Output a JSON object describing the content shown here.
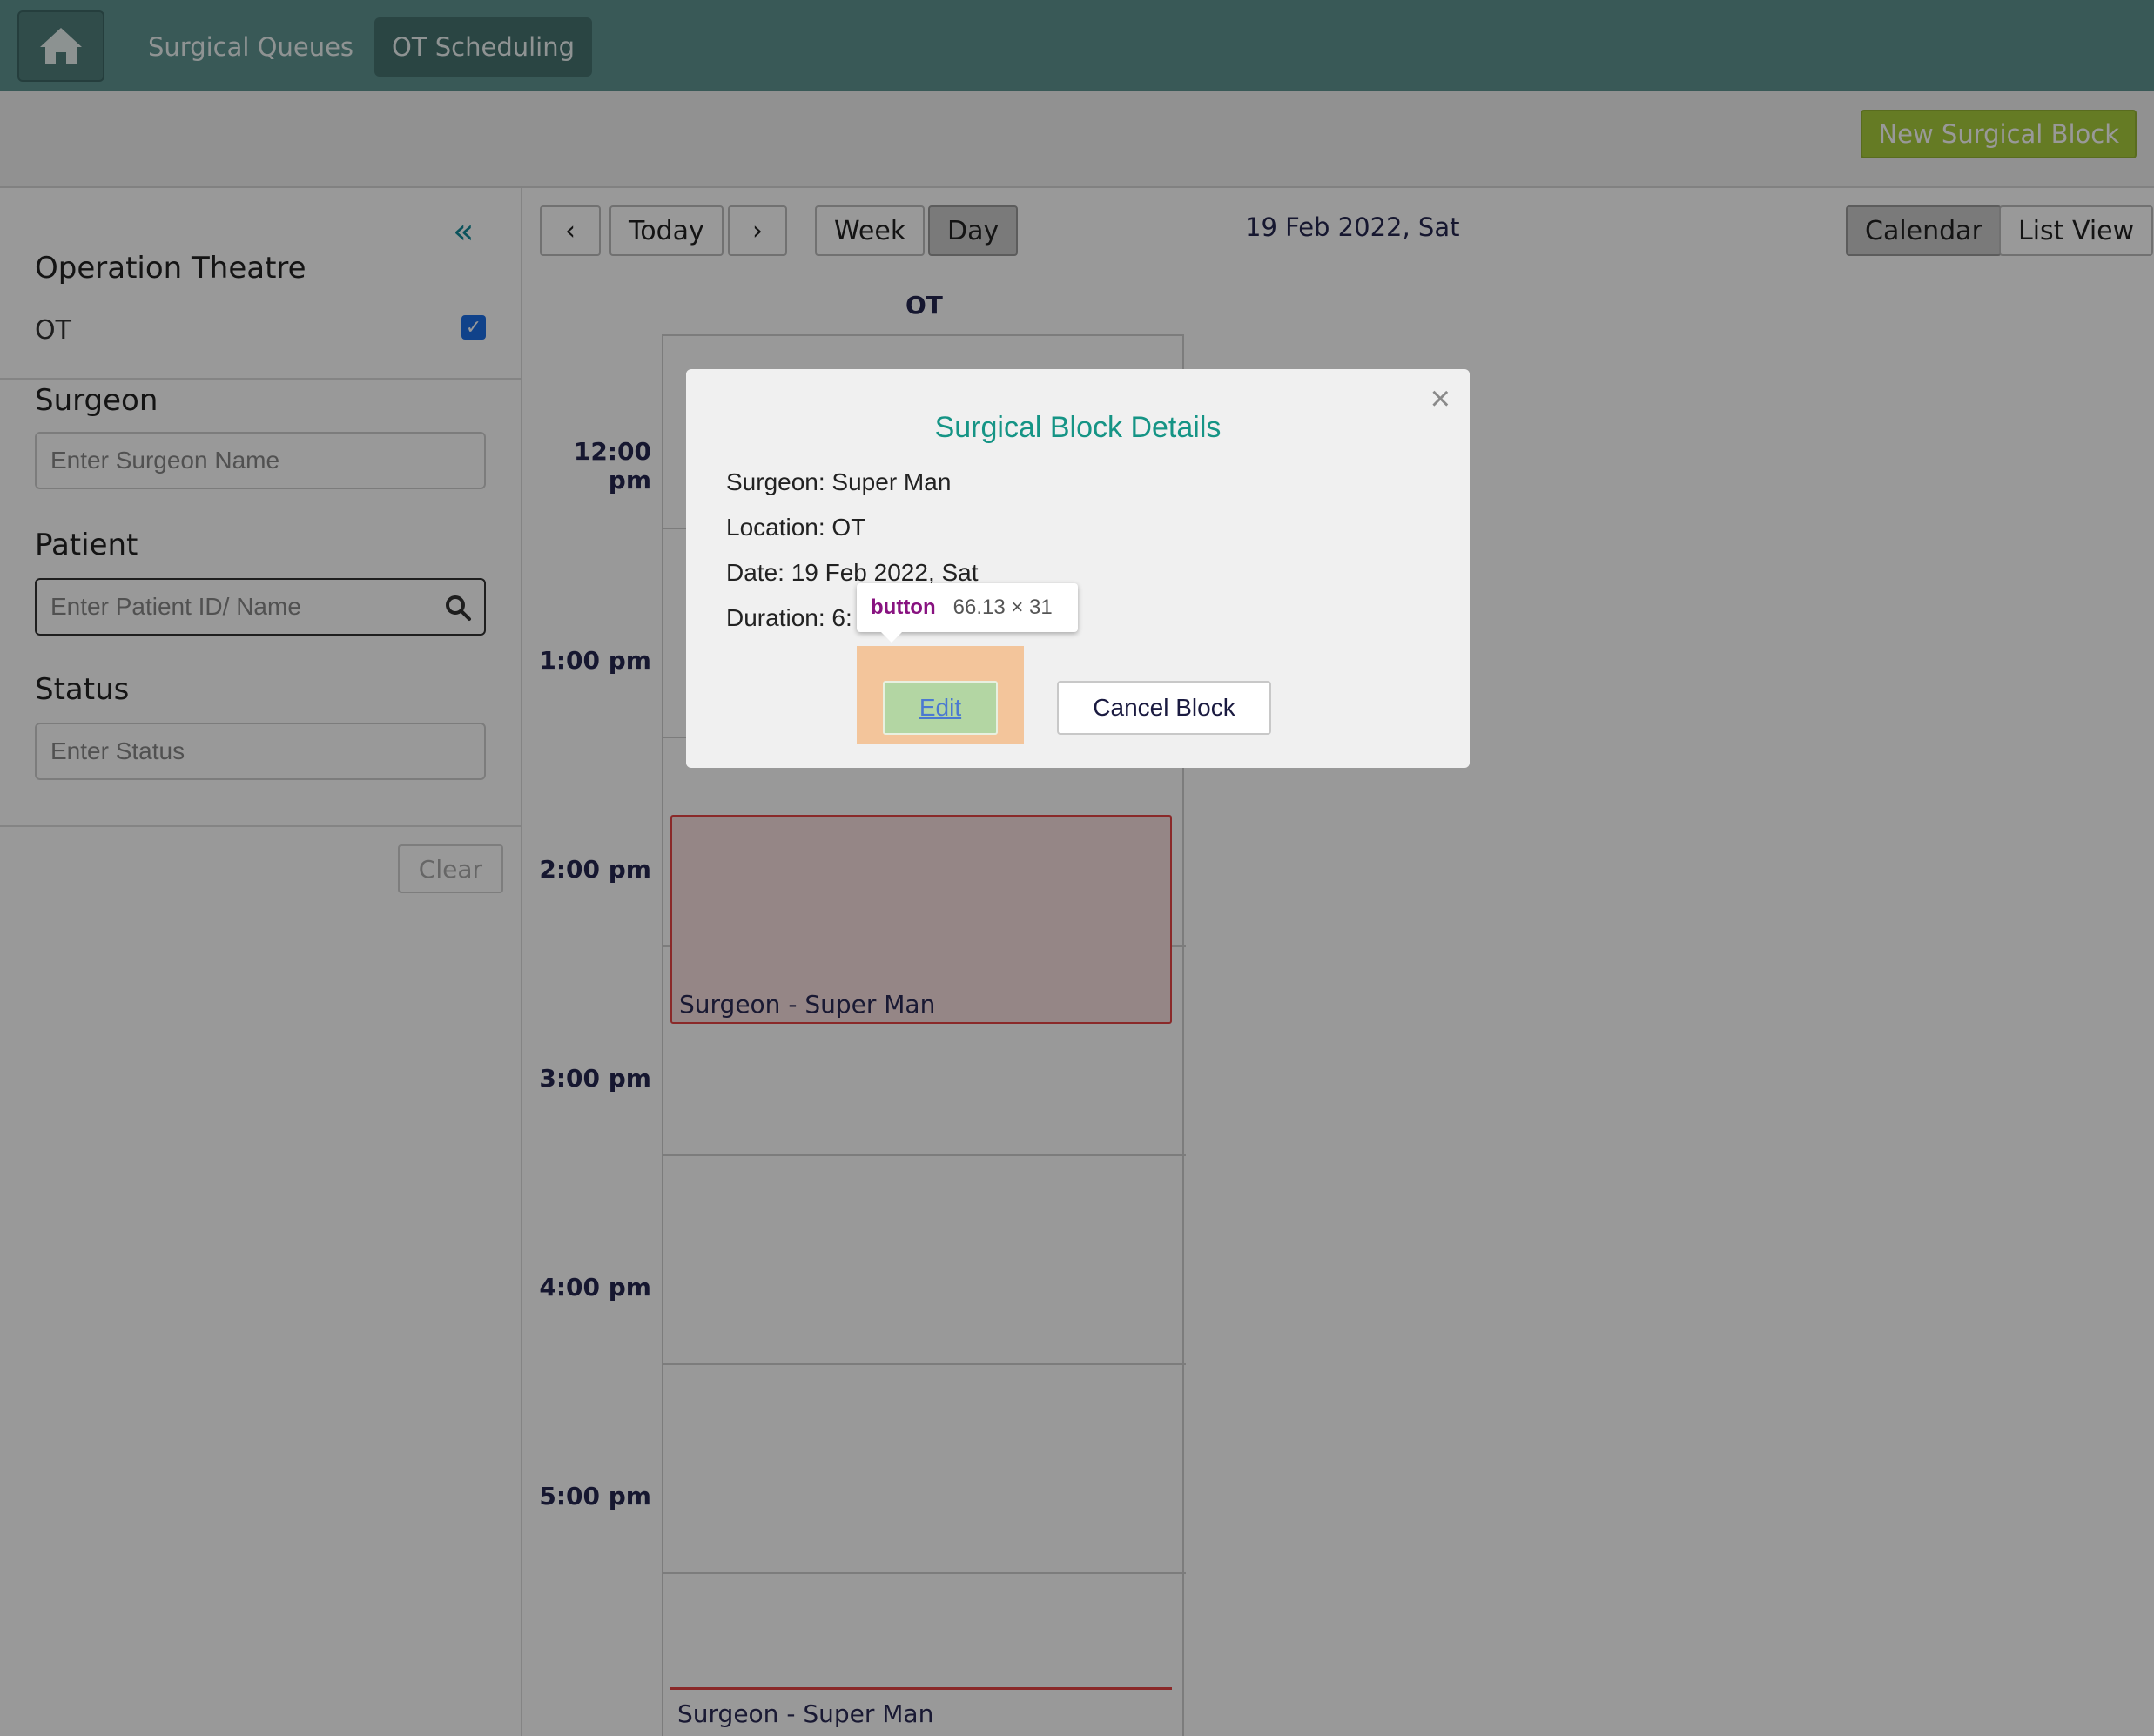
{
  "nav": {
    "home_icon": "home-icon",
    "links": [
      "Surgical Queues",
      "OT Scheduling"
    ],
    "active": "OT Scheduling"
  },
  "actionbar": {
    "new_block_label": "New Surgical Block"
  },
  "sidebar": {
    "collapse_icon": "«",
    "operation_theatre": {
      "heading": "Operation Theatre",
      "items": [
        {
          "label": "OT",
          "checked": true
        }
      ]
    },
    "surgeon": {
      "heading": "Surgeon",
      "placeholder": "Enter Surgeon Name"
    },
    "patient": {
      "heading": "Patient",
      "placeholder": "Enter Patient ID/ Name"
    },
    "status": {
      "heading": "Status",
      "placeholder": "Enter Status"
    },
    "clear_label": "Clear"
  },
  "calendar": {
    "prev_label": "‹",
    "today_label": "Today",
    "next_label": "›",
    "week_label": "Week",
    "day_label": "Day",
    "date": "19 Feb 2022, Sat",
    "calendar_label": "Calendar",
    "list_view_label": "List View",
    "column": "OT",
    "times": [
      "12:00 pm",
      "1:00 pm",
      "2:00 pm",
      "3:00 pm",
      "4:00 pm",
      "5:00 pm"
    ],
    "blocks": [
      {
        "label": "Surgeon - Super Man"
      },
      {
        "label": "Surgeon - Super Man"
      }
    ]
  },
  "modal": {
    "title": "Surgical Block Details",
    "close": "×",
    "surgeon": "Surgeon: Super Man",
    "location": "Location: OT",
    "date": "Date: 19 Feb 2022, Sat",
    "duration": "Duration: 6:",
    "edit_label": "Edit",
    "cancel_label": "Cancel Block"
  },
  "devtools_tooltip": {
    "tag": "button",
    "dimensions": "66.13 × 31"
  },
  "colors": {
    "nav_bg": "#5f9592",
    "accent_green": "#a9cd3c",
    "modal_title": "#159485",
    "block_border": "#e64545"
  }
}
